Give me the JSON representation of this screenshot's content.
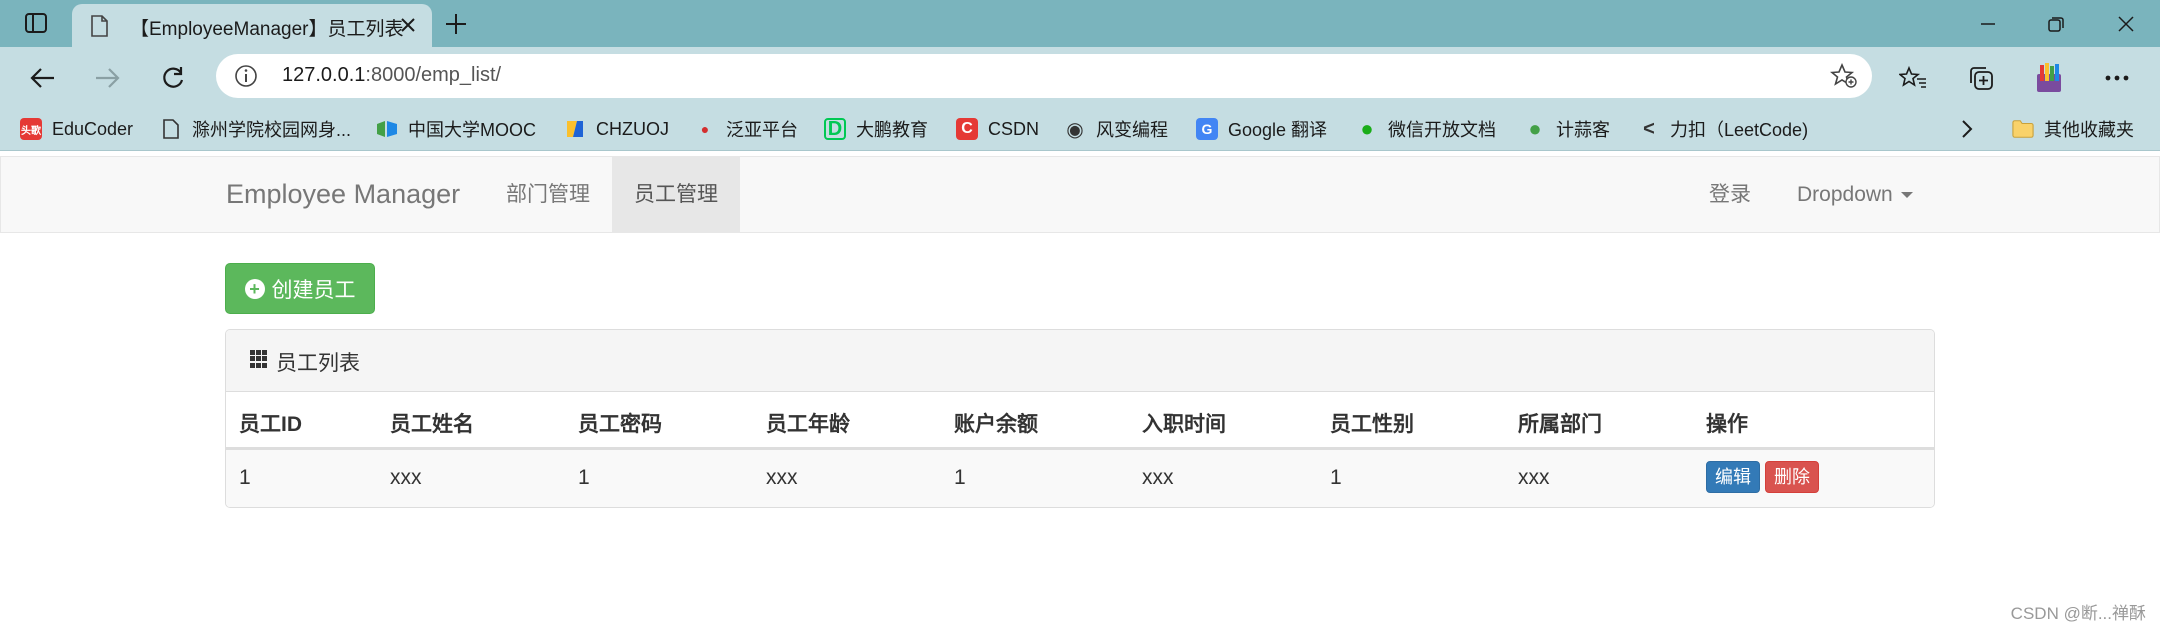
{
  "browser": {
    "tab_title": "【EmployeeManager】员工列表",
    "url_host": "127.0.0.1",
    "url_rest": ":8000/emp_list/",
    "bookmarks": [
      {
        "label": "EduCoder",
        "icon": "educoder-icon",
        "color": "#e53935",
        "glyph": "头歌"
      },
      {
        "label": "滁州学院校园网身...",
        "icon": "page-icon",
        "color": "#555555",
        "glyph": ""
      },
      {
        "label": "中国大学MOOC",
        "icon": "mooc-icon",
        "color": "#2e7d32",
        "glyph": ""
      },
      {
        "label": "CHZUOJ",
        "icon": "chzuoj-icon",
        "color": "#f4b400",
        "glyph": ""
      },
      {
        "label": "泛亚平台",
        "icon": "fanya-icon",
        "color": "#d32f2f",
        "glyph": "●"
      },
      {
        "label": "大鹏教育",
        "icon": "dapeng-icon",
        "color": "#00c853",
        "glyph": "D"
      },
      {
        "label": "CSDN",
        "icon": "csdn-icon",
        "color": "#e53935",
        "glyph": "C"
      },
      {
        "label": "风变编程",
        "icon": "fengbian-icon",
        "color": "#333333",
        "glyph": "◉"
      },
      {
        "label": "Google 翻译",
        "icon": "google-translate-icon",
        "color": "#4285f4",
        "glyph": "G"
      },
      {
        "label": "微信开放文档",
        "icon": "wechat-icon",
        "color": "#1aad19",
        "glyph": "●"
      },
      {
        "label": "计蒜客",
        "icon": "jisuanke-icon",
        "color": "#43a047",
        "glyph": "●"
      },
      {
        "label": "力扣（LeetCode)",
        "icon": "leetcode-icon",
        "color": "#333333",
        "glyph": "<"
      }
    ],
    "other_bookmarks": "其他收藏夹"
  },
  "navbar": {
    "brand": "Employee Manager",
    "links": [
      "部门管理",
      "员工管理"
    ],
    "login": "登录",
    "dropdown": "Dropdown"
  },
  "main": {
    "create_button": "创建员工",
    "panel_title": "员工列表",
    "columns": [
      "员工ID",
      "员工姓名",
      "员工密码",
      "员工年龄",
      "账户余额",
      "入职时间",
      "员工性别",
      "所属部门",
      "操作"
    ],
    "rows": [
      {
        "cells": [
          "1",
          "xxx",
          "1",
          "xxx",
          "1",
          "xxx",
          "1",
          "xxx"
        ],
        "edit": "编辑",
        "delete": "删除"
      }
    ]
  },
  "watermark": "CSDN @断...禅酥",
  "colors": {
    "tabstrip": "#7ab4bd",
    "toolbar": "#c5dde2",
    "success": "#5cb85c",
    "primary": "#337ab7",
    "danger": "#d9534f"
  }
}
